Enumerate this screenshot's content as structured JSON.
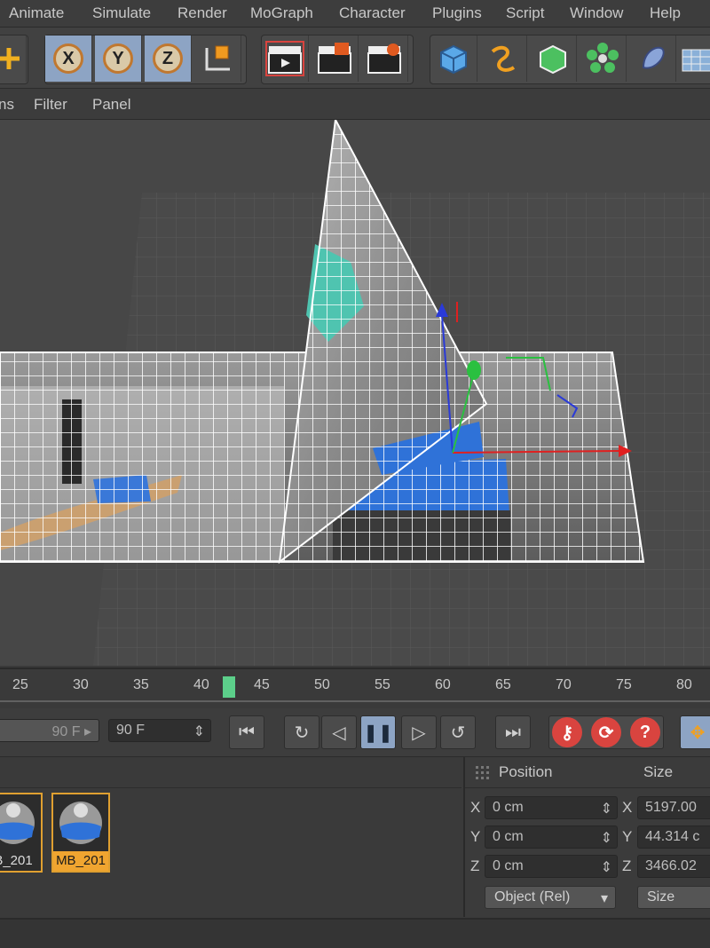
{
  "menu": [
    "Animate",
    "Simulate",
    "Render",
    "MoGraph",
    "Character",
    "Plugins",
    "Script",
    "Window",
    "Help"
  ],
  "toolbar": {
    "axis_x": "X",
    "axis_y": "Y",
    "axis_z": "Z"
  },
  "view_menu": [
    "ns",
    "Filter",
    "Panel"
  ],
  "timeline": {
    "ticks": [
      "25",
      "30",
      "35",
      "40",
      "45",
      "50",
      "55",
      "60",
      "65",
      "70",
      "75",
      "80"
    ],
    "current_frame": 42
  },
  "transport": {
    "start_field": "90 F",
    "end_field": "90 F",
    "help_glyph": "?"
  },
  "materials": [
    {
      "label": "B_201"
    },
    {
      "label": "MB_201"
    }
  ],
  "coords": {
    "position_header": "Position",
    "size_header": "Size",
    "rows": [
      {
        "axis": "X",
        "pos": "0 cm",
        "size": "5197.00"
      },
      {
        "axis": "Y",
        "pos": "0 cm",
        "size": "44.314 c"
      },
      {
        "axis": "Z",
        "pos": "0 cm",
        "size": "3466.02"
      }
    ],
    "mode_dropdown": "Object (Rel)",
    "size_dropdown": "Size"
  },
  "colors": {
    "accent_blue": "#8da4c4",
    "playhead": "#5ccf8a",
    "material_highlight": "#f0a530"
  }
}
